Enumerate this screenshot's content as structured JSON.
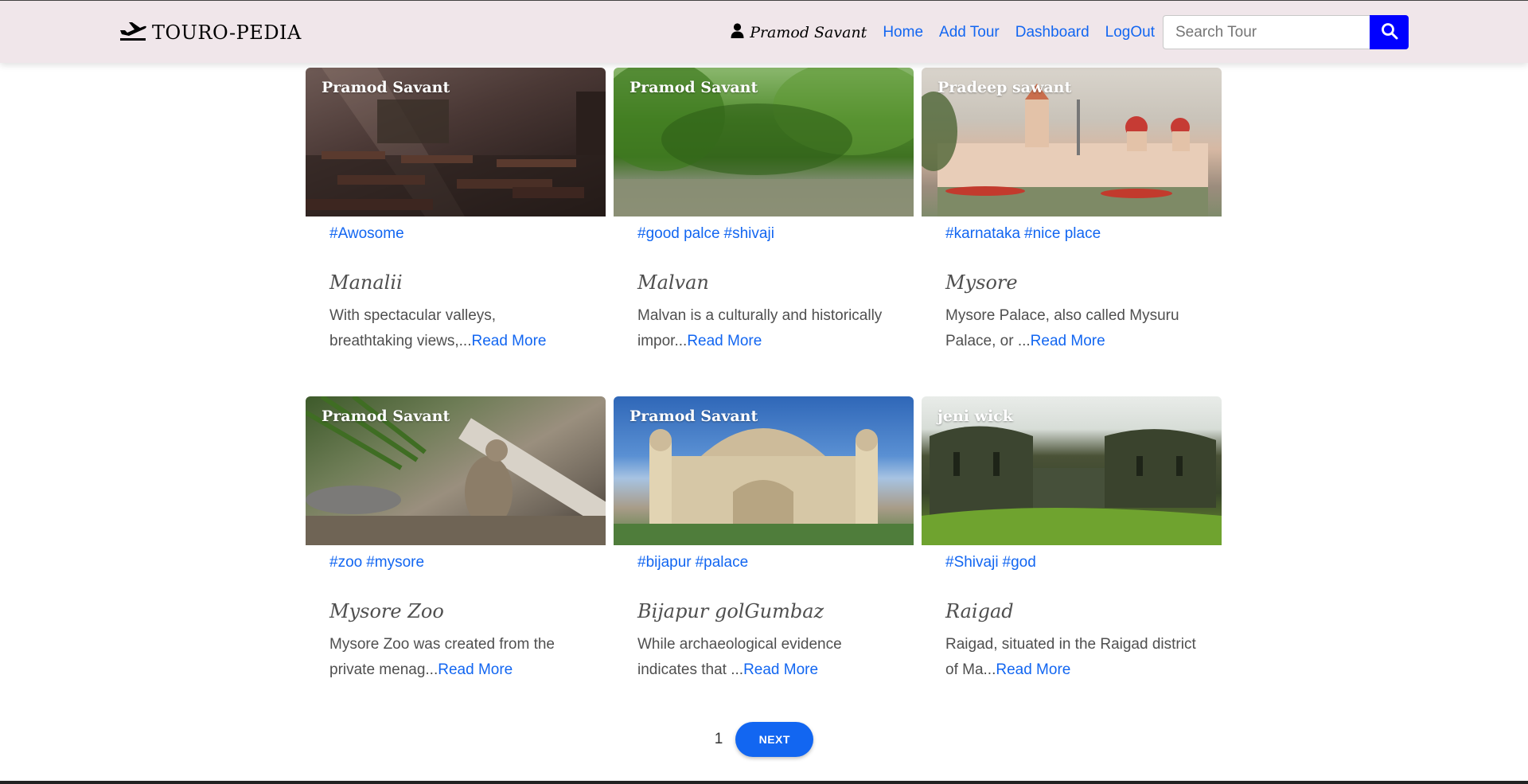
{
  "navbar": {
    "brand": "TOURO-PEDIA",
    "brand_icon": "plane-departure-icon",
    "user_icon": "user-icon",
    "user_name": "Pramod Savant",
    "links": [
      "Home",
      "Add Tour",
      "Dashboard",
      "LogOut"
    ],
    "search_placeholder": "Search Tour",
    "search_icon": "search-icon",
    "colors": {
      "background": "#f0e6ea",
      "link": "#1266f1",
      "search_button": "#0000ff"
    }
  },
  "tours": [
    {
      "author": "Pramod Savant",
      "tags": [
        "#Awosome"
      ],
      "title": "Manalii",
      "desc": "With spectacular valleys, breathtaking views,...",
      "read_more": "Read More"
    },
    {
      "author": "Pramod Savant",
      "tags": [
        "#good palce",
        "#shivaji"
      ],
      "title": "Malvan",
      "desc": "Malvan is a culturally and historically impor...",
      "read_more": "Read More"
    },
    {
      "author": "Pradeep sawant",
      "tags": [
        "#karnataka",
        "#nice place"
      ],
      "title": "Mysore",
      "desc": "Mysore Palace, also called Mysuru Palace, or ...",
      "read_more": "Read More"
    },
    {
      "author": "Pramod Savant",
      "tags": [
        "#zoo",
        "#mysore"
      ],
      "title": "Mysore Zoo",
      "desc": "Mysore Zoo was created from the private menag...",
      "read_more": "Read More"
    },
    {
      "author": "Pramod Savant",
      "tags": [
        "#bijapur",
        "#palace"
      ],
      "title": "Bijapur golGumbaz",
      "desc": "While archaeological evidence indicates that ...",
      "read_more": "Read More"
    },
    {
      "author": "jeni wick",
      "tags": [
        "#Shivaji",
        "#god"
      ],
      "title": "Raigad",
      "desc": "Raigad, situated in the Raigad district of Ma...",
      "read_more": "Read More"
    }
  ],
  "pagination": {
    "current_page": "1",
    "next_label": "NEXT"
  }
}
